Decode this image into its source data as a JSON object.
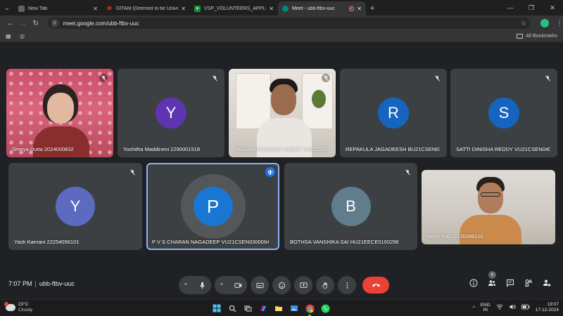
{
  "browser": {
    "tabs": [
      {
        "label": "New Tab",
        "active": false
      },
      {
        "label": "GITAM (Deemed to be University)",
        "active": false
      },
      {
        "label": "VSP_VOLUNTEERS_APPLICATION",
        "active": false
      },
      {
        "label": "Meet - ubb-ftbv-uuc",
        "active": true
      }
    ],
    "url": "meet.google.com/ubb-ftbv-uuc",
    "bookmarks_label": "All Bookmarks"
  },
  "meeting": {
    "time": "7:07 PM",
    "code": "ubb-ftbv-uuc",
    "participants_badge": "9",
    "participants": [
      {
        "name": "Shreya Dutta 2024000832",
        "type": "video",
        "muted": true
      },
      {
        "name": "Yoshitha Maddineni 2290001518",
        "type": "avatar",
        "initial": "Y",
        "color": "#5e35b1",
        "muted": true
      },
      {
        "name": "YADABA VAISHNAV KREET HU21CSE...",
        "type": "video",
        "muted": true
      },
      {
        "name": "REPAKULA JAGADEESH BU21CSEN03...",
        "type": "avatar",
        "initial": "R",
        "color": "#1565c0",
        "muted": true
      },
      {
        "name": "SATTI DINISHA REDDY VU21CSEN040...",
        "type": "avatar",
        "initial": "S",
        "color": "#1565c0",
        "muted": true
      },
      {
        "name": "Yash Karnani 22254056101",
        "type": "avatar",
        "initial": "Y",
        "color": "#5c6bc0",
        "muted": true
      },
      {
        "name": "P V S CHARAN NAGADEEP VU21CSEN0300064",
        "type": "avatar",
        "initial": "P",
        "color": "#1976d2",
        "speaking": true
      },
      {
        "name": "BOTHSA VANSHIKA SAI HU21EECE0100296",
        "type": "avatar",
        "initial": "B",
        "color": "#607d8b",
        "muted": true
      },
      {
        "name": "Nitish Raj 22135396101",
        "type": "video",
        "muted": false
      }
    ]
  },
  "taskbar": {
    "temperature": "23°C",
    "weather": "Cloudy",
    "lang_top": "ENG",
    "lang_bottom": "IN",
    "clock_time": "19:07",
    "clock_date": "17-12-2024"
  },
  "colors": {
    "accent": "#8ab4f8",
    "end_call": "#ea4335",
    "tile_bg": "#3c4043"
  }
}
